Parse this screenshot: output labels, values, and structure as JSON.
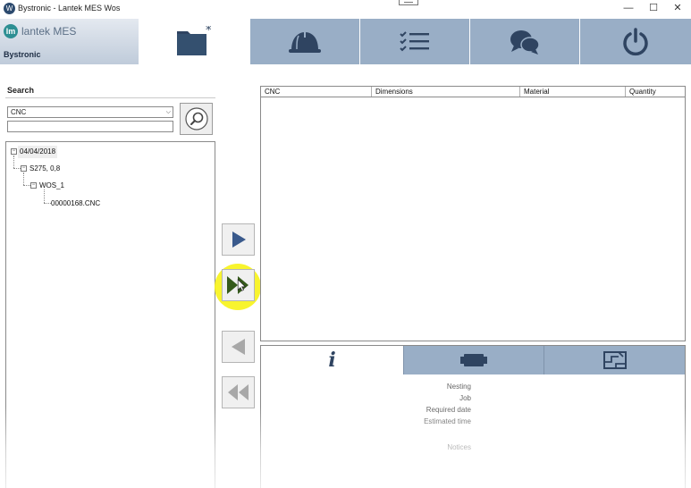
{
  "window": {
    "title": "Bystronic - Lantek MES Wos",
    "app_icon_glyph": "W",
    "minimize_glyph": "—",
    "maximize_glyph": "☐",
    "close_glyph": "✕"
  },
  "logo": {
    "mark": "lm",
    "product": "lantek MES",
    "company": "Bystronic"
  },
  "nav": {
    "tabs": [
      {
        "icon": "folder-new-icon",
        "active": true
      },
      {
        "icon": "hard-hat-icon"
      },
      {
        "icon": "task-list-icon"
      },
      {
        "icon": "chat-bubbles-icon"
      },
      {
        "icon": "power-icon"
      }
    ]
  },
  "search": {
    "label": "Search",
    "type_selected": "CNC",
    "query": "",
    "chevron": "⌵"
  },
  "tree": {
    "nodes": [
      {
        "level": 0,
        "label": "04/04/2018",
        "expander": "−"
      },
      {
        "level": 1,
        "label": "S275, 0,8",
        "expander": "−"
      },
      {
        "level": 2,
        "label": "WOS_1",
        "expander": "−"
      },
      {
        "level": 3,
        "label": "00000168.CNC"
      }
    ]
  },
  "grid": {
    "columns": [
      "CNC",
      "Dimensions",
      "Material",
      "Quantity"
    ],
    "rows": []
  },
  "details": {
    "info_glyph": "i",
    "fields": [
      "Nesting",
      "Job",
      "Required date",
      "Estimated time",
      "Notices"
    ]
  },
  "colors": {
    "nav_tab": "#99aec6",
    "icon_dark": "#2f4461",
    "highlight": "#f8f31e",
    "transfer_arrow": "#3a5a8c"
  }
}
